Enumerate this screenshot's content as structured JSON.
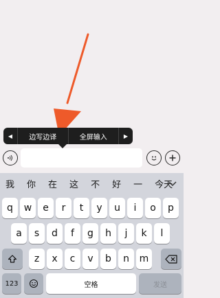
{
  "popup": {
    "left_arrow": "◀",
    "item1": "边写边译",
    "item2": "全屏输入",
    "right_arrow": "▶"
  },
  "input_bar": {
    "voice_icon": "voice-icon",
    "emoji_icon": "emoji-icon",
    "plus_icon": "plus-icon"
  },
  "candidates": [
    "我",
    "你",
    "在",
    "这",
    "不",
    "好",
    "一",
    "今天"
  ],
  "keyboard": {
    "row1": [
      "q",
      "w",
      "e",
      "r",
      "t",
      "y",
      "u",
      "i",
      "o",
      "p"
    ],
    "row2": [
      "a",
      "s",
      "d",
      "f",
      "g",
      "h",
      "j",
      "k",
      "l"
    ],
    "row3": [
      "z",
      "x",
      "c",
      "v",
      "b",
      "n",
      "m"
    ],
    "numbers_key": "123",
    "space_key": "空格",
    "send_key": "发送"
  }
}
